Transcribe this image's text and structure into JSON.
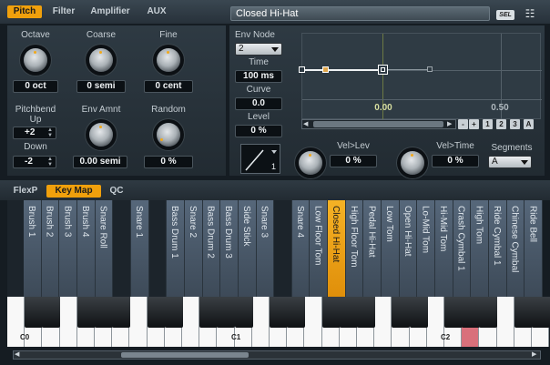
{
  "tabs": [
    "Pitch",
    "Filter",
    "Amplifier",
    "AUX"
  ],
  "instrument_name": "Closed Hi-Hat",
  "sel_label": "SEL",
  "pitch": {
    "octave_label": "Octave",
    "octave_value": "0 oct",
    "coarse_label": "Coarse",
    "coarse_value": "0 semi",
    "fine_label": "Fine",
    "fine_value": "0 cent",
    "pitchbend_label": "Pitchbend",
    "up_label": "Up",
    "up_value": "+2",
    "down_label": "Down",
    "down_value": "-2",
    "env_amnt_label": "Env Amnt",
    "env_amnt_value": "0.00 semi",
    "random_label": "Random",
    "random_value": "0 %"
  },
  "envelope": {
    "env_node_label": "Env Node",
    "env_node_value": "2",
    "time_label": "Time",
    "time_value": "100 ms",
    "curve_label": "Curve",
    "curve_value": "0.0",
    "level_label": "Level",
    "level_value": "0 %",
    "ruler_0": "0.00",
    "ruler_1": "0.50",
    "btn_minus": "-",
    "btn_plus": "+",
    "btn_1": "1",
    "btn_2": "2",
    "btn_3": "3",
    "btn_a": "A",
    "shape_number": "1",
    "vel_lev_label": "Vel>Lev",
    "vel_lev_value": "0 %",
    "vel_time_label": "Vel>Time",
    "vel_time_value": "0 %",
    "segments_label": "Segments",
    "segments_value": "A"
  },
  "bottom_tabs": [
    "FlexP",
    "Key Map",
    "QC"
  ],
  "key_map": [
    "Brush 1",
    "Brush 2",
    "Brush 3",
    "Brush 4",
    "Snare Roll",
    "",
    "Snare 1",
    "",
    "Bass Drum 1",
    "Snare 2",
    "Bass Drum 2",
    "Bass Drum 3",
    "Side Stick",
    "Snare 3",
    "",
    "Snare 4",
    "Low Floor Tom",
    "Closed Hi-Hat",
    "High Floor Tom",
    "Pedal Hi-Hat",
    "Low Tom",
    "Open Hi-Hat",
    "Lo-Mid Tom",
    "Hi-Mid Tom",
    "Crash Cymbal 1",
    "High Tom",
    "Ride Cymbal 1",
    "Chinese Cymbal",
    "Ride Bell"
  ],
  "octave_labels": [
    "C0",
    "C1",
    "C2"
  ],
  "colors": {
    "accent": "#f0a00c",
    "highlight_key": "#d9707b"
  }
}
